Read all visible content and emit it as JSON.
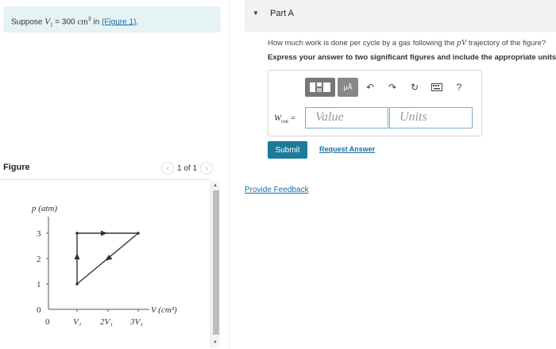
{
  "problem": {
    "prefix": "Suppose ",
    "var_main": "V",
    "var_sub": "1",
    "equals": " = 300 ",
    "unit": "cm",
    "unit_exp": "3",
    "in_text": " in ",
    "link_text": "(Figure 1)",
    "suffix": "."
  },
  "figure": {
    "title": "Figure",
    "pager": "1 of 1",
    "prev_icon": "chevron-left-icon",
    "next_icon": "chevron-right-icon",
    "y_axis_label": "p (atm)",
    "x_axis_label": "V (cm³)",
    "y_ticks": [
      "0",
      "1",
      "2",
      "3"
    ],
    "x_ticks": [
      "0",
      "V₁",
      "2V₁",
      "3V₁"
    ]
  },
  "part": {
    "label": "Part A",
    "question_prefix": "How much work is done per cycle by a gas following the ",
    "question_var": "pV",
    "question_suffix": " trajectory of the figure?",
    "instructions": "Express your answer to two significant figures and include the appropriate units.",
    "toolbar": {
      "templates_icon": "templates-icon",
      "units_label": "μÅ",
      "undo_icon": "undo-icon",
      "redo_icon": "redo-icon",
      "reset_icon": "reset-icon",
      "keyboard_icon": "keyboard-icon",
      "help_label": "?"
    },
    "answer_label_main": "W",
    "answer_label_sub": "out",
    "answer_label_eq": " =",
    "value_placeholder": "Value",
    "units_placeholder": "Units",
    "submit_label": "Submit",
    "request_label": "Request Answer"
  },
  "feedback_label": "Provide Feedback",
  "colors": {
    "accent": "#1d7a9b",
    "link": "#1a6ea8",
    "banner": "#e6f3f4"
  }
}
